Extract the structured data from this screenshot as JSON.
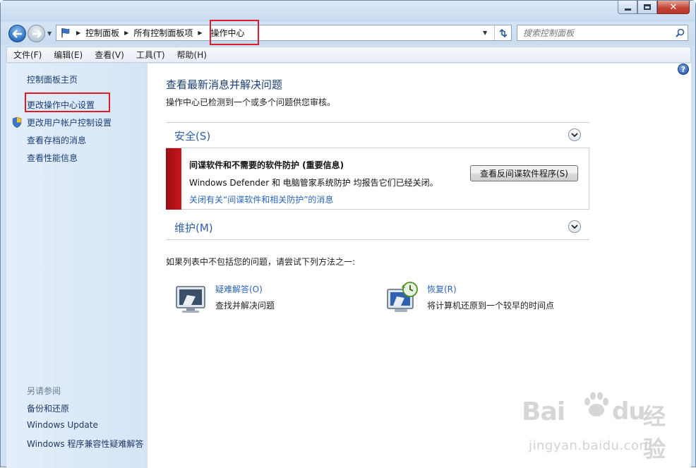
{
  "window": {
    "controls": {
      "minimize": "minimize",
      "maximize": "maximize",
      "close": "✕"
    }
  },
  "address_bar": {
    "breadcrumb": [
      "控制面板",
      "所有控制面板项",
      "操作中心"
    ],
    "search_placeholder": "搜索控制面板"
  },
  "menu": [
    "文件(F)",
    "编辑(E)",
    "查看(V)",
    "工具(T)",
    "帮助(H)"
  ],
  "sidebar": {
    "home": "控制面板主页",
    "links": [
      "更改操作中心设置",
      "更改用户帐户控制设置",
      "查看存档的消息",
      "查看性能信息"
    ],
    "see_also_title": "另请参阅",
    "see_also": [
      "备份和还原",
      "Windows Update",
      "Windows 程序兼容性疑难解答"
    ]
  },
  "main": {
    "title": "查看最新消息并解决问题",
    "subtitle": "操作中心已检测到一个或多个问题供您审核。",
    "security": {
      "heading": "安全(S)",
      "alert_title": "间谍软件和不需要的软件防护 (重要信息)",
      "alert_desc": "Windows Defender 和 电脑管家系统防护 均报告它们已经关闭。",
      "alert_link": "关闭有关“间谍软件和相关防护”的消息",
      "alert_button": "查看反间谍软件程序(S)"
    },
    "maintenance": {
      "heading": "维护(M)"
    },
    "try_text": "如果列表中不包括您的问题，请尝试下列方法之一:",
    "tools": [
      {
        "name": "疑难解答(O)",
        "desc": "查找并解决问题"
      },
      {
        "name": "恢复(R)",
        "desc": "将计算机还原到一个较早的时间点"
      }
    ]
  },
  "watermark": {
    "brand": "Bai",
    "brand_cn": "经验",
    "url": "jingyan.baidu.com"
  },
  "colors": {
    "link": "#1a3e74",
    "accent_link": "#2a66b5",
    "alert_red": "#c8161e",
    "highlight_box": "#e01c2b"
  }
}
